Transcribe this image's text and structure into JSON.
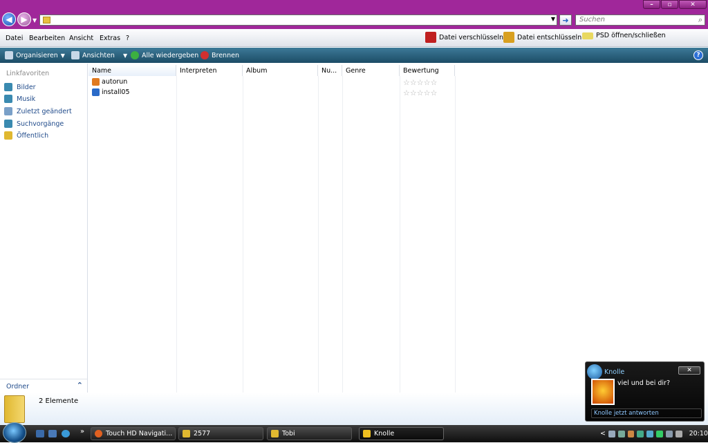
{
  "window": {
    "min_label": "–",
    "max_label": "▫",
    "close_label": "✕"
  },
  "address": {
    "value": "",
    "search_placeholder": "Suchen"
  },
  "menu": {
    "items": [
      "Datei",
      "Bearbeiten",
      "Ansicht",
      "Extras",
      "?"
    ]
  },
  "commands": {
    "encrypt": "Datei verschlüsseln",
    "decrypt": "Datei entschlüsseln",
    "psd": "PSD öffnen/schließen"
  },
  "toolbar": {
    "organize": "Organisieren",
    "views": "Ansichten",
    "play_all": "Alle wiedergeben",
    "burn": "Brennen"
  },
  "nav": {
    "header": "Linkfavoriten",
    "items": [
      "Bilder",
      "Musik",
      "Zuletzt geändert",
      "Suchvorgänge",
      "Öffentlich"
    ],
    "ordner": "Ordner"
  },
  "columns": [
    "Name",
    "Interpreten",
    "Album",
    "Nu...",
    "Genre",
    "Bewertung"
  ],
  "files": [
    {
      "name": "autorun"
    },
    {
      "name": "install05"
    }
  ],
  "status": {
    "count": "2 Elemente"
  },
  "taskbar": {
    "tasks": [
      "Touch HD Navigati...",
      "2577",
      "Tobi",
      "Knolle"
    ],
    "chevron": "»",
    "time": "20:10",
    "tray_chevron": "<"
  },
  "popup": {
    "name": "Knolle",
    "message": "viel und bei dir?",
    "reply": "Knolle jetzt antworten",
    "close": "✕"
  },
  "colors": {
    "title_purple": "#a0279a",
    "toolbar_blue": "#2c5f7c",
    "link_blue": "#1f4a8a"
  },
  "icons": [
    "back-arrow-icon",
    "forward-arrow-icon",
    "folder-icon",
    "go-arrow-icon",
    "search-icon",
    "lock-red-icon",
    "lock-yellow-icon",
    "psd-icon",
    "organize-icon",
    "views-icon",
    "play-icon",
    "burn-icon",
    "help-icon"
  ]
}
